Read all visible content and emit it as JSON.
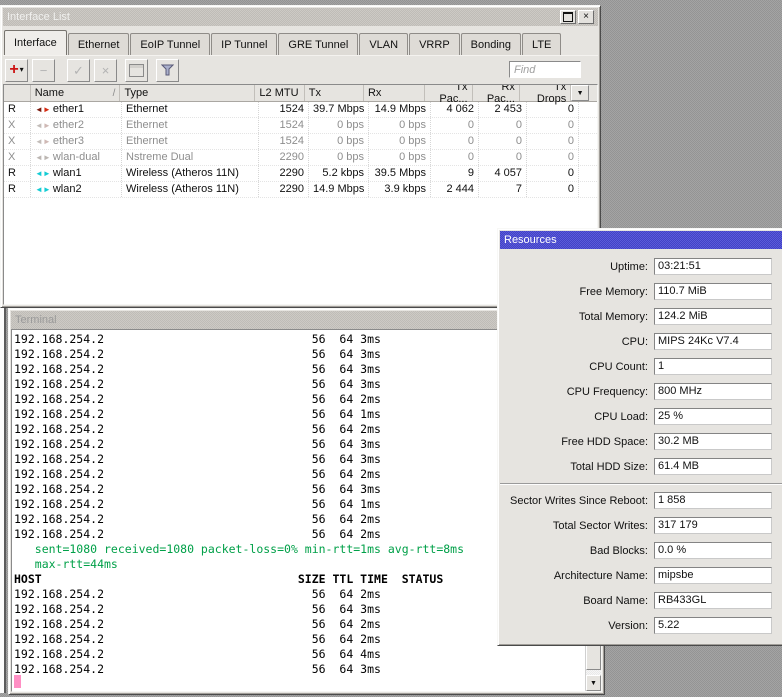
{
  "colors": {
    "titlebar_active_blue": "#4a4ac8",
    "terminal_green": "#00a048",
    "terminal_cursor_pink": "#ff8fc4",
    "add_button_red": "#cc1111",
    "wireless_icon_cyan": "#14ccd4",
    "ethernet_icon_red": "#d42a10",
    "disabled_text": "#8e8e8e"
  },
  "interface_list": {
    "title": "Interface List",
    "window_buttons": {
      "close": "×"
    },
    "tabs": [
      {
        "label": "Interface",
        "cls": "tab-active"
      },
      {
        "label": "Ethernet",
        "cls": ""
      },
      {
        "label": "EoIP Tunnel",
        "cls": ""
      },
      {
        "label": "IP Tunnel",
        "cls": ""
      },
      {
        "label": "GRE Tunnel",
        "cls": ""
      },
      {
        "label": "VLAN",
        "cls": ""
      },
      {
        "label": "VRRP",
        "cls": ""
      },
      {
        "label": "Bonding",
        "cls": ""
      },
      {
        "label": "LTE",
        "cls": ""
      }
    ],
    "toolbar": {
      "add_glyph": "+",
      "add_caret": "▾",
      "remove_glyph": "−",
      "enable_glyph": "✓",
      "disable_glyph": "×",
      "find_placeholder": "Find"
    },
    "header": {
      "name": "Name",
      "sort_glyph": "/",
      "type": "Type",
      "l2mtu": "L2 MTU",
      "tx": "Tx",
      "rx": "Rx",
      "tx_pac": "Tx Pac...",
      "rx_pac": "Rx Pac...",
      "tx_drops": "Tx Drops",
      "dropdown_glyph": "▼"
    },
    "rows": [
      {
        "flag": "R",
        "name": "ether1",
        "type": "Ethernet",
        "l2mtu": "1524",
        "tx": "39.7 Mbps",
        "rx": "14.9 Mbps",
        "tx_pac": "4 062",
        "rx_pac": "2 453",
        "tx_drops": "0",
        "cls": "",
        "icon_left": "#7a1a0e",
        "icon_right": "#d42a10"
      },
      {
        "flag": "X",
        "name": "ether2",
        "type": "Ethernet",
        "l2mtu": "1524",
        "tx": "0 bps",
        "rx": "0 bps",
        "tx_pac": "0",
        "rx_pac": "0",
        "tx_drops": "0",
        "cls": "row-disabled",
        "icon_left": "#c3bdb9",
        "icon_right": "#cfb9b5"
      },
      {
        "flag": "X",
        "name": "ether3",
        "type": "Ethernet",
        "l2mtu": "1524",
        "tx": "0 bps",
        "rx": "0 bps",
        "tx_pac": "0",
        "rx_pac": "0",
        "tx_drops": "0",
        "cls": "row-disabled",
        "icon_left": "#c3bdb9",
        "icon_right": "#cfb9b5"
      },
      {
        "flag": "X",
        "name": "wlan-dual",
        "type": "Nstreme Dual",
        "l2mtu": "2290",
        "tx": "0 bps",
        "rx": "0 bps",
        "tx_pac": "0",
        "rx_pac": "0",
        "tx_drops": "0",
        "cls": "row-disabled",
        "icon_left": "#bcb6b2",
        "icon_right": "#bcb6b2"
      },
      {
        "flag": "R",
        "name": "wlan1",
        "type": "Wireless (Atheros 11N)",
        "l2mtu": "2290",
        "tx": "5.2 kbps",
        "rx": "39.5 Mbps",
        "tx_pac": "9",
        "rx_pac": "4 057",
        "tx_drops": "0",
        "cls": "",
        "icon_left": "#14ccd4",
        "icon_right": "#14ccd4"
      },
      {
        "flag": "R",
        "name": "wlan2",
        "type": "Wireless (Atheros 11N)",
        "l2mtu": "2290",
        "tx": "14.9 Mbps",
        "rx": "3.9 kbps",
        "tx_pac": "2 444",
        "rx_pac": "7",
        "tx_drops": "0",
        "cls": "",
        "icon_left": "#14ccd4",
        "icon_right": "#14ccd4"
      }
    ]
  },
  "terminal": {
    "title": "Terminal",
    "lines": [
      {
        "text": "192.168.254.2                              56  64 3ms",
        "cls": ""
      },
      {
        "text": "192.168.254.2                              56  64 3ms",
        "cls": ""
      },
      {
        "text": "192.168.254.2                              56  64 3ms",
        "cls": ""
      },
      {
        "text": "192.168.254.2                              56  64 3ms",
        "cls": ""
      },
      {
        "text": "192.168.254.2                              56  64 2ms",
        "cls": ""
      },
      {
        "text": "192.168.254.2                              56  64 1ms",
        "cls": ""
      },
      {
        "text": "192.168.254.2                              56  64 2ms",
        "cls": ""
      },
      {
        "text": "192.168.254.2                              56  64 3ms",
        "cls": ""
      },
      {
        "text": "192.168.254.2                              56  64 3ms",
        "cls": ""
      },
      {
        "text": "192.168.254.2                              56  64 2ms",
        "cls": ""
      },
      {
        "text": "192.168.254.2                              56  64 3ms",
        "cls": ""
      },
      {
        "text": "192.168.254.2                              56  64 1ms",
        "cls": ""
      },
      {
        "text": "192.168.254.2                              56  64 2ms",
        "cls": ""
      },
      {
        "text": "192.168.254.2                              56  64 2ms",
        "cls": ""
      },
      {
        "text": "   sent=1080 received=1080 packet-loss=0% min-rtt=1ms avg-rtt=8ms",
        "cls": "t-green"
      },
      {
        "text": "   max-rtt=44ms",
        "cls": "t-green"
      },
      {
        "text": "HOST                                     SIZE TTL TIME  STATUS",
        "cls": "t-bold"
      },
      {
        "text": "192.168.254.2                              56  64 2ms",
        "cls": ""
      },
      {
        "text": "192.168.254.2                              56  64 3ms",
        "cls": ""
      },
      {
        "text": "192.168.254.2                              56  64 2ms",
        "cls": ""
      },
      {
        "text": "192.168.254.2                              56  64 2ms",
        "cls": ""
      },
      {
        "text": "192.168.254.2                              56  64 4ms",
        "cls": ""
      },
      {
        "text": "192.168.254.2                              56  64 3ms",
        "cls": ""
      }
    ],
    "scroll_up_glyph": "▲",
    "scroll_down_glyph": "▼"
  },
  "resources": {
    "title": "Resources",
    "fields_top": [
      {
        "label": "Uptime:",
        "value": "03:21:51"
      },
      {
        "label": "Free Memory:",
        "value": "110.7 MiB"
      },
      {
        "label": "Total Memory:",
        "value": "124.2 MiB"
      },
      {
        "label": "CPU:",
        "value": "MIPS 24Kc V7.4"
      },
      {
        "label": "CPU Count:",
        "value": "1"
      },
      {
        "label": "CPU Frequency:",
        "value": "800 MHz"
      },
      {
        "label": "CPU Load:",
        "value": "25 %"
      },
      {
        "label": "Free HDD Space:",
        "value": "30.2 MB"
      },
      {
        "label": "Total HDD Size:",
        "value": "61.4 MB"
      }
    ],
    "fields_bottom": [
      {
        "label": "Sector Writes Since Reboot:",
        "value": "1 858"
      },
      {
        "label": "Total Sector Writes:",
        "value": "317 179"
      },
      {
        "label": "Bad Blocks:",
        "value": "0.0 %"
      },
      {
        "label": "Architecture Name:",
        "value": "mipsbe"
      },
      {
        "label": "Board Name:",
        "value": "RB433GL"
      },
      {
        "label": "Version:",
        "value": "5.22"
      }
    ]
  }
}
